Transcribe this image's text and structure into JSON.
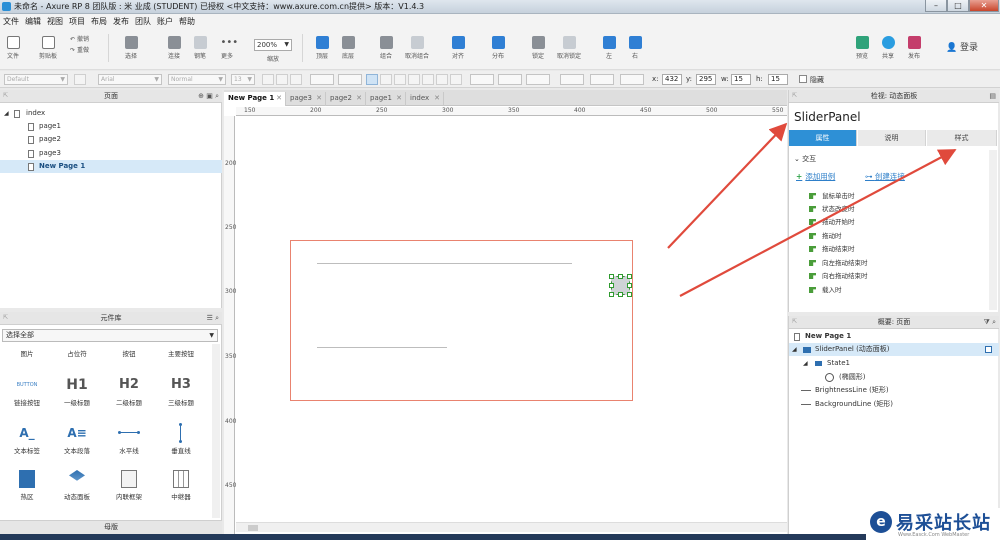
{
  "window": {
    "title": "未命名 - Axure RP 8 团队版 : 米 业成 (STUDENT) 已授权     <中文支持：www.axure.com.cn提供> 版本：V1.4.3",
    "min": "–",
    "max": "□",
    "close": "✕"
  },
  "menu": [
    "文件",
    "编辑",
    "视图",
    "项目",
    "布局",
    "发布",
    "团队",
    "账户",
    "帮助"
  ],
  "toolbar": {
    "file": "文件",
    "clipboard": "剪贴板",
    "undo": "撤销",
    "redo": "重做",
    "select": "选择",
    "connect": "连接",
    "pen": "钢笔",
    "more": "更多",
    "zoom_value": "200%",
    "zoom_label": "缩放",
    "top": "顶层",
    "bottom": "底层",
    "group": "组合",
    "ungroup": "取消组合",
    "align": "对齐",
    "distribute": "分布",
    "lock": "锁定",
    "unlock": "取消锁定",
    "left": "左",
    "right": "右",
    "preview": "预览",
    "share": "共享",
    "publish": "发布",
    "login": "登录"
  },
  "formatbar": {
    "style": "Default",
    "font": "Arial",
    "weight": "Normal",
    "size": "13",
    "x_label": "x:",
    "x": "432",
    "y_label": "y:",
    "y": "295",
    "w_label": "w:",
    "w": "15",
    "h_label": "h:",
    "h": "15",
    "hidden_label": "隐藏"
  },
  "pages_panel": {
    "title": "页面",
    "items": [
      {
        "label": "index",
        "level": 0
      },
      {
        "label": "page1",
        "level": 1
      },
      {
        "label": "page2",
        "level": 1
      },
      {
        "label": "page3",
        "level": 1
      },
      {
        "label": "New Page 1",
        "level": 1,
        "selected": true
      }
    ]
  },
  "library_panel": {
    "title": "元件库",
    "select": "选择全部",
    "widgets": [
      {
        "label": "图片",
        "glyph": ""
      },
      {
        "label": "占位符",
        "glyph": ""
      },
      {
        "label": "按钮",
        "glyph": ""
      },
      {
        "label": "主要按钮",
        "glyph": ""
      },
      {
        "label": "链接按钮",
        "glyph": "BUTTON"
      },
      {
        "label": "一级标题",
        "glyph": "H1"
      },
      {
        "label": "二级标题",
        "glyph": "H2"
      },
      {
        "label": "三级标题",
        "glyph": "H3"
      },
      {
        "label": "文本标签",
        "glyph": "A_"
      },
      {
        "label": "文本段落",
        "glyph": "A≡"
      },
      {
        "label": "水平线",
        "glyph": ""
      },
      {
        "label": "垂直线",
        "glyph": ""
      },
      {
        "label": "热区",
        "glyph": ""
      },
      {
        "label": "动态面板",
        "glyph": ""
      },
      {
        "label": "内联框架",
        "glyph": ""
      },
      {
        "label": "中继器",
        "glyph": ""
      }
    ],
    "masters_title": "母版"
  },
  "canvas": {
    "tabs": [
      "New Page 1",
      "page3",
      "page2",
      "page1",
      "index"
    ],
    "ruler_h": [
      "150",
      "200",
      "250",
      "300",
      "350",
      "400",
      "450",
      "500",
      "550"
    ],
    "ruler_v": [
      "200",
      "250",
      "300",
      "350",
      "400",
      "450"
    ]
  },
  "inspector": {
    "header": "检视: 动态面板",
    "title": "SliderPanel",
    "tabs": [
      "属性",
      "说明",
      "样式"
    ],
    "section": "交互",
    "add_case": "添加用例",
    "create_link": "创建连接",
    "events": [
      "鼠标单击时",
      "状态改变时",
      "拖动开始时",
      "拖动时",
      "拖动结束时",
      "向左拖动结束时",
      "向右拖动结束时",
      "载入时"
    ]
  },
  "outline": {
    "header": "概要: 页面",
    "page": "New Page 1",
    "items": [
      {
        "label": "SliderPanel (动态面板)",
        "level": 0,
        "selected": true
      },
      {
        "label": "State1",
        "level": 1
      },
      {
        "label": "(椭圆形)",
        "level": 2
      },
      {
        "label": "BrightnessLine (矩形)",
        "level": 0
      },
      {
        "label": "BackgroundLine (矩形)",
        "level": 0
      }
    ]
  },
  "watermark": {
    "logo": "e",
    "text": "易采站长站",
    "sub": "Www.Easck.Com  WebMaster"
  },
  "colors": {
    "accent": "#2e90d6",
    "panel_border": "#e9836f",
    "arrow": "#e04a3c"
  }
}
